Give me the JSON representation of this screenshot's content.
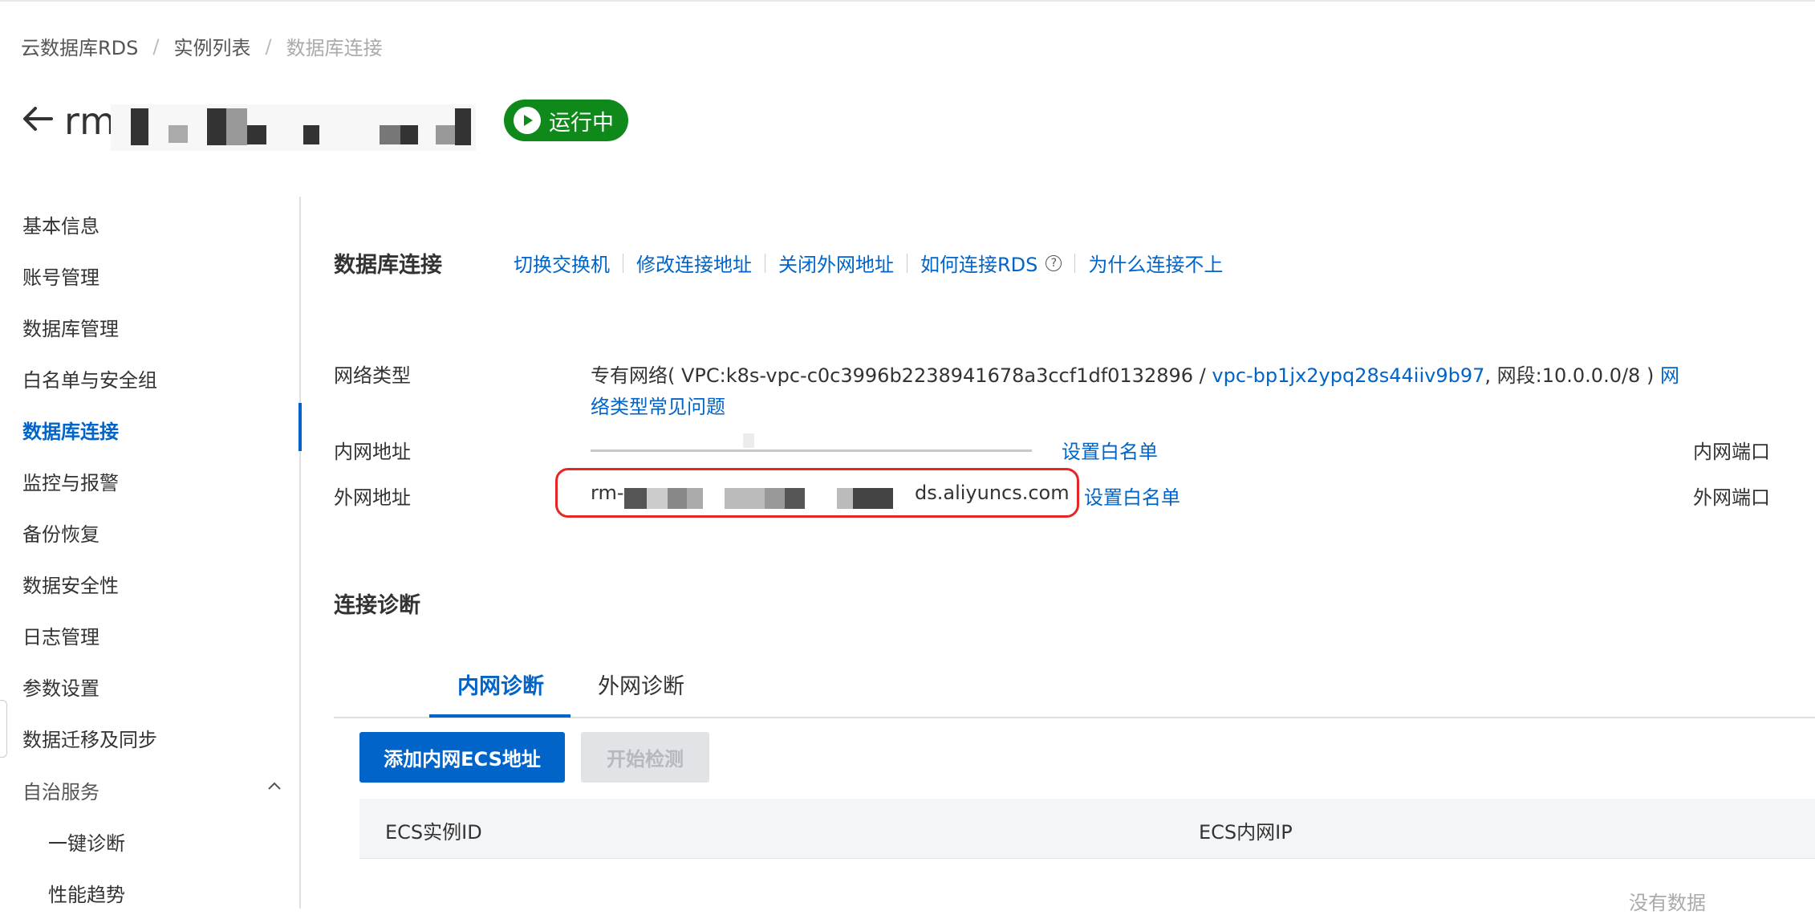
{
  "breadcrumb": {
    "items": [
      "云数据库RDS",
      "实例列表",
      "数据库连接"
    ],
    "separator": "/"
  },
  "header": {
    "title_prefix": "rm",
    "status": "运行中"
  },
  "sidebar": {
    "items": [
      {
        "label": "基本信息"
      },
      {
        "label": "账号管理"
      },
      {
        "label": "数据库管理"
      },
      {
        "label": "白名单与安全组"
      },
      {
        "label": "数据库连接",
        "active": true
      },
      {
        "label": "监控与报警"
      },
      {
        "label": "备份恢复"
      },
      {
        "label": "数据安全性"
      },
      {
        "label": "日志管理"
      },
      {
        "label": "参数设置"
      },
      {
        "label": "数据迁移及同步"
      },
      {
        "label": "自治服务",
        "expanded": true
      }
    ],
    "subitems": [
      {
        "label": "一键诊断"
      },
      {
        "label": "性能趋势"
      }
    ]
  },
  "db_connection": {
    "title": "数据库连接",
    "actions": [
      "切换交换机",
      "修改连接地址",
      "关闭外网地址",
      "如何连接RDS",
      "为什么连接不上"
    ],
    "help_icon": "?"
  },
  "network": {
    "type_label": "网络类型",
    "type_prefix": "专有网络( VPC:k8s-vpc-c0c3996b2238941678a3ccf1df0132896 / ",
    "vpc_link": "vpc-bp1jx2ypq28s44iiv9b97",
    "segment": ", 网段:10.0.0.0/8 ) ",
    "faq_part1": "网",
    "faq_part2": "络类型常见问题",
    "internal_label": "内网地址",
    "internal_whitelist": "设置白名单",
    "internal_port_label": "内网端口",
    "external_label": "外网地址",
    "external_prefix": "rm-",
    "external_suffix": "ds.aliyuncs.com",
    "external_whitelist": "设置白名单",
    "external_port_label": "外网端口"
  },
  "diagnosis": {
    "title": "连接诊断",
    "tabs": [
      "内网诊断",
      "外网诊断"
    ],
    "add_button": "添加内网ECS地址",
    "start_button": "开始检测",
    "columns": [
      "ECS实例ID",
      "ECS内网IP"
    ],
    "empty_text": "没有数据"
  },
  "colors": {
    "primary": "#0064c8",
    "status_green": "#0f8a1a",
    "highlight_red": "#e62525"
  }
}
